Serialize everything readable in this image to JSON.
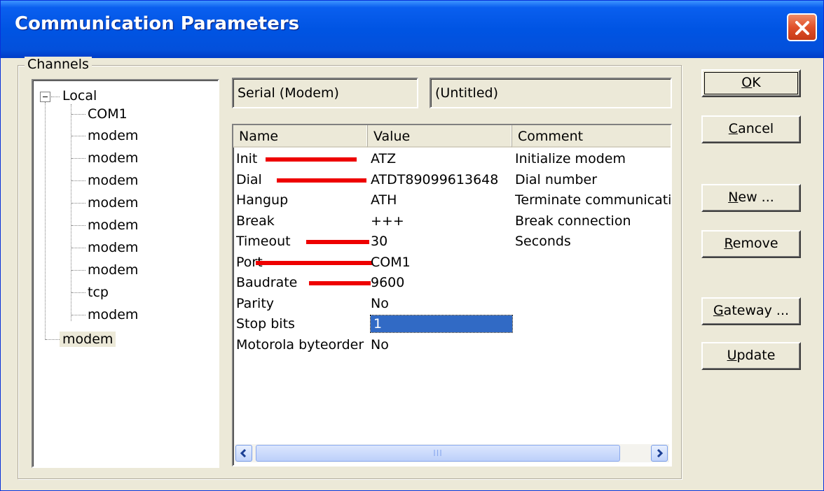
{
  "window": {
    "title": "Communication Parameters"
  },
  "channels": {
    "label": "Channels",
    "tree": {
      "root": "Local",
      "children": [
        "COM1",
        "modem",
        "modem",
        "modem",
        "modem",
        "modem",
        "modem",
        "modem",
        "tcp",
        "modem"
      ],
      "selected": "modem"
    }
  },
  "channel_info": {
    "type": "Serial (Modem)",
    "name": "(Untitled)"
  },
  "params": {
    "columns": [
      "Name",
      "Value",
      "Comment"
    ],
    "rows": [
      {
        "name": "Init",
        "value": "ATZ",
        "comment": "Initialize modem"
      },
      {
        "name": "Dial",
        "value": "ATDT89099613648",
        "comment": "Dial number"
      },
      {
        "name": "Hangup",
        "value": "ATH",
        "comment": "Terminate communicati"
      },
      {
        "name": "Break",
        "value": "+++",
        "comment": "Break connection"
      },
      {
        "name": "Timeout",
        "value": "30",
        "comment": "Seconds"
      },
      {
        "name": "Port",
        "value": "COM1",
        "comment": ""
      },
      {
        "name": "Baudrate",
        "value": "9600",
        "comment": ""
      },
      {
        "name": "Parity",
        "value": "No",
        "comment": ""
      },
      {
        "name": "Stop bits",
        "value": "1",
        "comment": ""
      },
      {
        "name": "Motorola byteorder",
        "value": "No",
        "comment": ""
      }
    ],
    "selected_value_row": 8
  },
  "scrollbar": {
    "grip": "III"
  },
  "buttons": {
    "ok": {
      "mnemonic": "O",
      "rest": "K"
    },
    "cancel": {
      "mnemonic": "C",
      "rest": "ancel"
    },
    "new": {
      "mnemonic": "N",
      "rest": "ew ..."
    },
    "remove": {
      "mnemonic": "R",
      "rest": "emove"
    },
    "gateway": {
      "mnemonic": "G",
      "rest": "ateway ..."
    },
    "update": {
      "mnemonic": "U",
      "rest": "pdate"
    }
  },
  "colors": {
    "titlebar": "#0054e3",
    "dialog_bg": "#ece9d8",
    "selection": "#316ac5",
    "redaction": "#ee0000"
  }
}
